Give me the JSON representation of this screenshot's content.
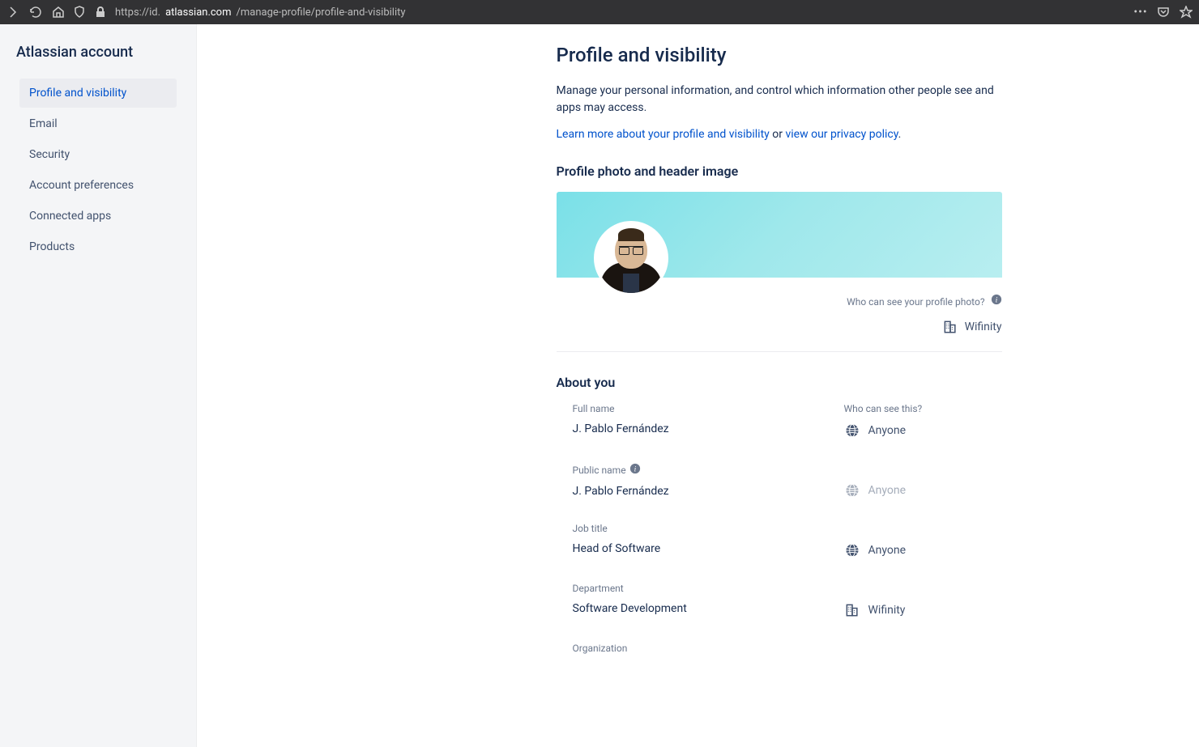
{
  "browser": {
    "url_prefix": "https://id.",
    "url_domain": "atlassian.com",
    "url_path": "/manage-profile/profile-and-visibility"
  },
  "sidebar": {
    "title": "Atlassian account",
    "items": [
      {
        "label": "Profile and visibility",
        "active": true
      },
      {
        "label": "Email",
        "active": false
      },
      {
        "label": "Security",
        "active": false
      },
      {
        "label": "Account preferences",
        "active": false
      },
      {
        "label": "Connected apps",
        "active": false
      },
      {
        "label": "Products",
        "active": false
      }
    ]
  },
  "page": {
    "title": "Profile and visibility",
    "description": "Manage your personal information, and control which information other people see and apps may access.",
    "link1": "Learn more about your profile and visibility",
    "link_sep": " or ",
    "link2": "view our privacy policy",
    "link_end": "."
  },
  "photo_section": {
    "heading": "Profile photo and header image",
    "who_label": "Who can see your profile photo?",
    "visibility": "Wifinity"
  },
  "about": {
    "heading": "About you",
    "who_header": "Who can see this?",
    "fields": [
      {
        "label": "Full name",
        "value": "J. Pablo Fernández",
        "visibility": "Anyone",
        "icon": "globe",
        "disabled": false,
        "info": false
      },
      {
        "label": "Public name",
        "value": "J. Pablo Fernández",
        "visibility": "Anyone",
        "icon": "globe",
        "disabled": true,
        "info": true
      },
      {
        "label": "Job title",
        "value": "Head of Software",
        "visibility": "Anyone",
        "icon": "globe",
        "disabled": false,
        "info": false
      },
      {
        "label": "Department",
        "value": "Software Development",
        "visibility": "Wifinity",
        "icon": "building",
        "disabled": false,
        "info": false
      },
      {
        "label": "Organization",
        "value": "",
        "visibility": "",
        "icon": "",
        "disabled": false,
        "info": false
      }
    ]
  }
}
